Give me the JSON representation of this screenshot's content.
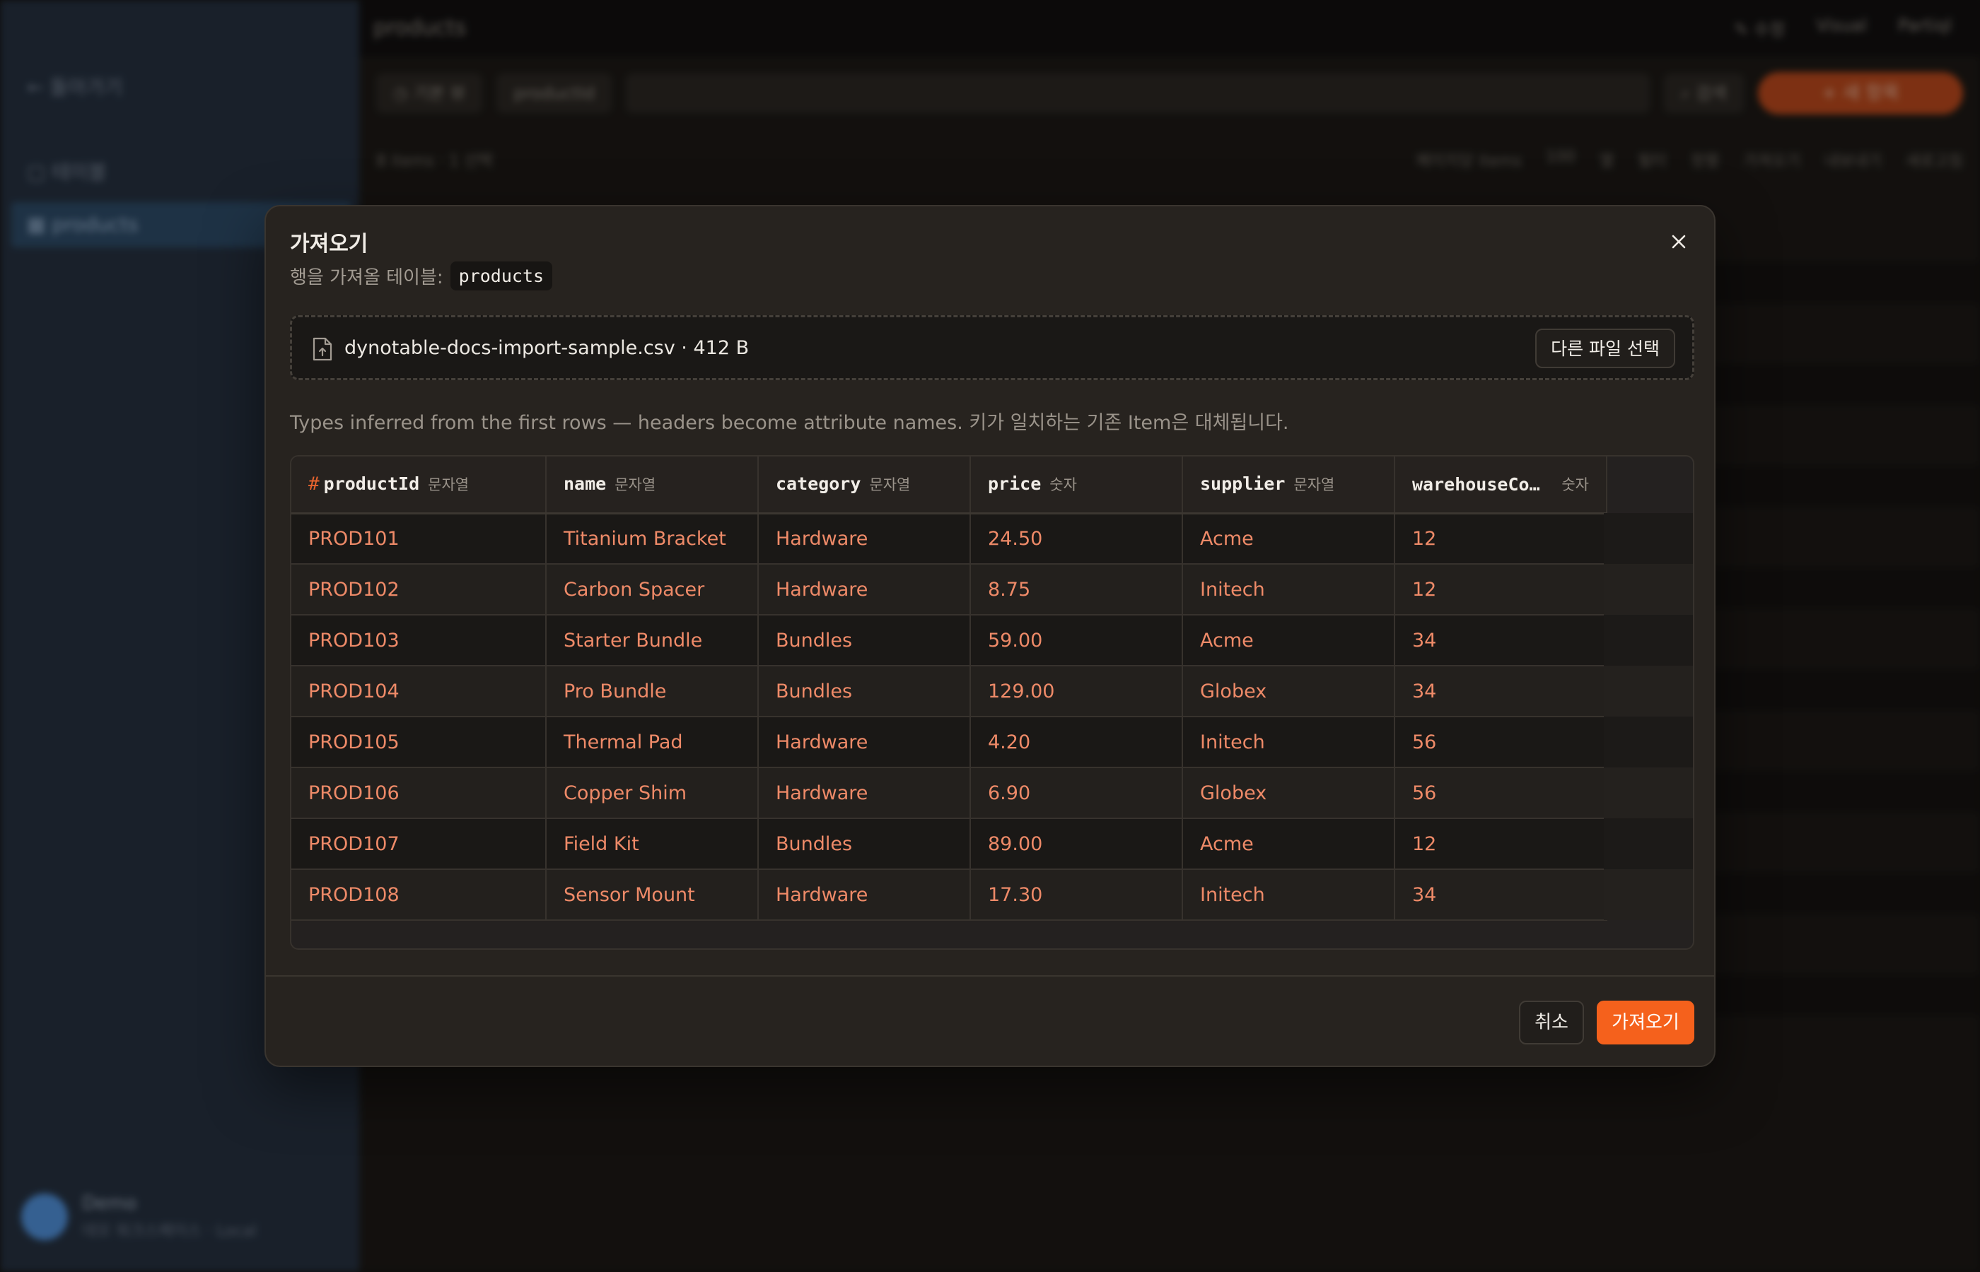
{
  "background": {
    "sidebar": {
      "back_label": "← 돌아가기",
      "items": [
        {
          "label": "▢ 테이블"
        },
        {
          "label": "▦ products"
        }
      ],
      "user": {
        "name": "Demo",
        "sub": "데모 워크스페이스 · Local"
      }
    },
    "main": {
      "title": "products",
      "top_right": [
        "✎ 수정",
        "Visual",
        "Partiql"
      ],
      "toolbar": {
        "filter": "◷ 기본 뷰",
        "key": "productId",
        "search_btn": "⌕ 검색",
        "new_btn": "+ 새 항목"
      },
      "subbar_left": "8 items · 1 선택",
      "subbar_right": [
        "페이지당 items",
        "100",
        "열",
        "필터",
        "정렬",
        "가져오기",
        "내보내기",
        "새로고침"
      ]
    }
  },
  "modal": {
    "title": "가져오기",
    "subtitle_label": "행을 가져올 테이블:",
    "table_name": "products",
    "file_name": "dynotable-docs-import-sample.csv · 412 B",
    "change_file_label": "다른 파일 선택",
    "hint": "Types inferred from the first rows — headers become attribute names. 키가 일치하는 기존 Item은 대체됩니다.",
    "columns": [
      {
        "name": "productId",
        "type": "문자열",
        "key": true
      },
      {
        "name": "name",
        "type": "문자열"
      },
      {
        "name": "category",
        "type": "문자열"
      },
      {
        "name": "price",
        "type": "숫자"
      },
      {
        "name": "supplier",
        "type": "문자열"
      },
      {
        "name": "warehouseCo…",
        "type": "숫자"
      }
    ],
    "key_marker": "#",
    "rows": [
      [
        "PROD101",
        "Titanium Bracket",
        "Hardware",
        "24.50",
        "Acme",
        "12"
      ],
      [
        "PROD102",
        "Carbon Spacer",
        "Hardware",
        "8.75",
        "Initech",
        "12"
      ],
      [
        "PROD103",
        "Starter Bundle",
        "Bundles",
        "59.00",
        "Acme",
        "34"
      ],
      [
        "PROD104",
        "Pro Bundle",
        "Bundles",
        "129.00",
        "Globex",
        "34"
      ],
      [
        "PROD105",
        "Thermal Pad",
        "Hardware",
        "4.20",
        "Initech",
        "56"
      ],
      [
        "PROD106",
        "Copper Shim",
        "Hardware",
        "6.90",
        "Globex",
        "56"
      ],
      [
        "PROD107",
        "Field Kit",
        "Bundles",
        "89.00",
        "Acme",
        "12"
      ],
      [
        "PROD108",
        "Sensor Mount",
        "Hardware",
        "17.30",
        "Initech",
        "34"
      ]
    ],
    "cancel_label": "취소",
    "import_label": "가져오기"
  },
  "colors": {
    "accent": "#f5611c",
    "cell_text": "#ee8a68",
    "modal_bg": "#27231f"
  }
}
